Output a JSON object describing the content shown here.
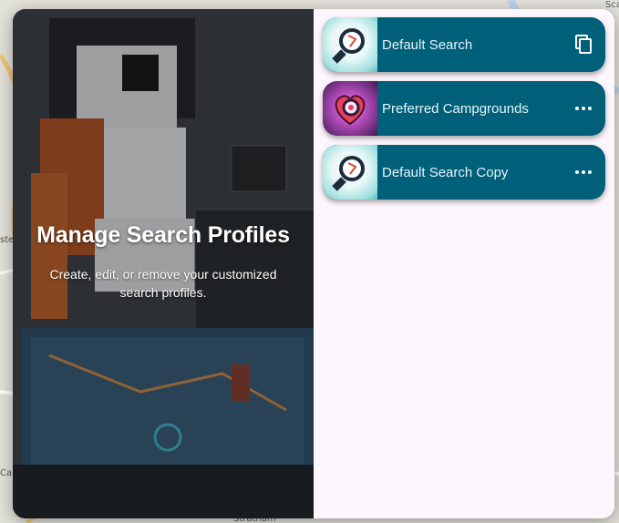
{
  "hero": {
    "title": "Manage Search Profiles",
    "subtitle": "Create, edit, or remove your customized search profiles."
  },
  "map": {
    "labels": [
      "Stratham",
      "Sca",
      "ste",
      "Car"
    ]
  },
  "profiles": [
    {
      "label": "Default Search",
      "thumb_icon": "magnifier-map-icon",
      "action_icon": "copy-icon"
    },
    {
      "label": "Preferred Campgrounds",
      "thumb_icon": "heart-magnifier-icon",
      "action_icon": "more-horizontal-icon"
    },
    {
      "label": "Default Search Copy",
      "thumb_icon": "magnifier-map-icon",
      "action_icon": "more-horizontal-icon"
    }
  ],
  "colors": {
    "card_bg": "#00607a",
    "panel_bg": "#fdf7fd",
    "hero_bg": "#2c2f33"
  }
}
